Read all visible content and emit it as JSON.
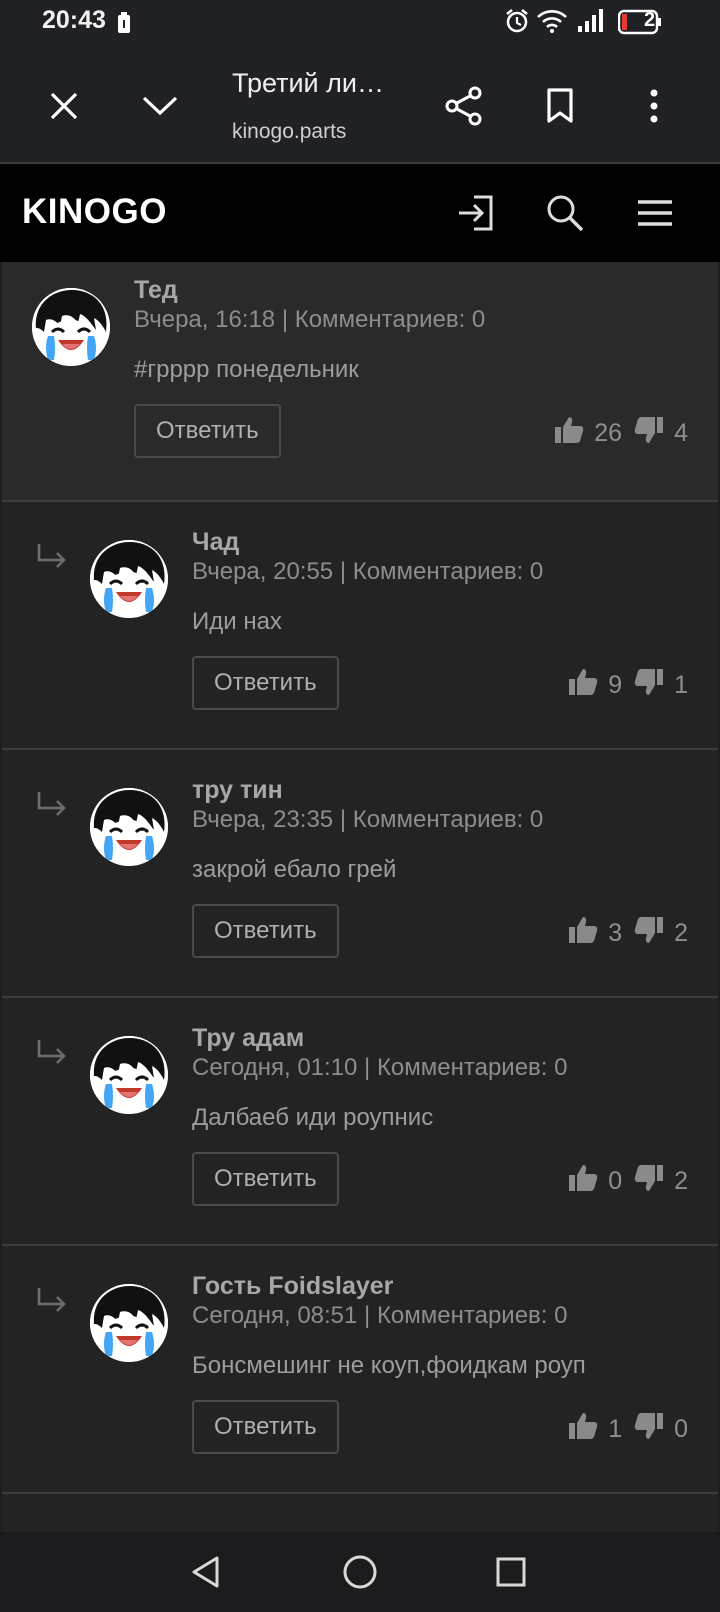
{
  "status_bar": {
    "time": "20:43",
    "battery_level": "2",
    "icons": [
      "battery-saver-icon",
      "alarm-icon",
      "wifi-icon",
      "signal-icon",
      "battery-icon"
    ]
  },
  "tab_bar": {
    "title": "Третий ли…",
    "url": "kinogo.parts",
    "icons": [
      "close-icon",
      "chevron-down-icon",
      "share-icon",
      "bookmark-icon",
      "more-vert-icon"
    ]
  },
  "site_header": {
    "logo": "KINOGO",
    "icons": [
      "login-icon",
      "search-icon",
      "menu-icon"
    ]
  },
  "comments": [
    {
      "author": "Тед",
      "meta": "Вчера, 16:18 | Комментариев: 0",
      "text": "#грррр понедельник",
      "reply_label": "Ответить",
      "likes": "26",
      "dislikes": "4",
      "is_reply": false
    },
    {
      "author": "Чад",
      "meta": "Вчера, 20:55 | Комментариев: 0",
      "text": "Иди нах",
      "reply_label": "Ответить",
      "likes": "9",
      "dislikes": "1",
      "is_reply": true
    },
    {
      "author": "тру тин",
      "meta": "Вчера, 23:35 | Комментариев: 0",
      "text": "закрой ебало грей",
      "reply_label": "Ответить",
      "likes": "3",
      "dislikes": "2",
      "is_reply": true
    },
    {
      "author": "Тру адам",
      "meta": "Сегодня, 01:10 | Комментариев: 0",
      "text": "Далбаеб иди роупнис",
      "reply_label": "Ответить",
      "likes": "0",
      "dislikes": "2",
      "is_reply": true
    },
    {
      "author": "Гость Foidslayer",
      "meta": "Сегодня, 08:51 | Комментариев: 0",
      "text": "Бонсмешинг не коуп,фоидкам роуп",
      "reply_label": "Ответить",
      "likes": "1",
      "dislikes": "0",
      "is_reply": true
    }
  ],
  "nav_bar": {
    "icons": [
      "back-icon",
      "home-icon",
      "recents-icon"
    ]
  },
  "colors": {
    "background": "#1e1e1e",
    "header": "#000000",
    "tab_bar": "#202124"
  }
}
